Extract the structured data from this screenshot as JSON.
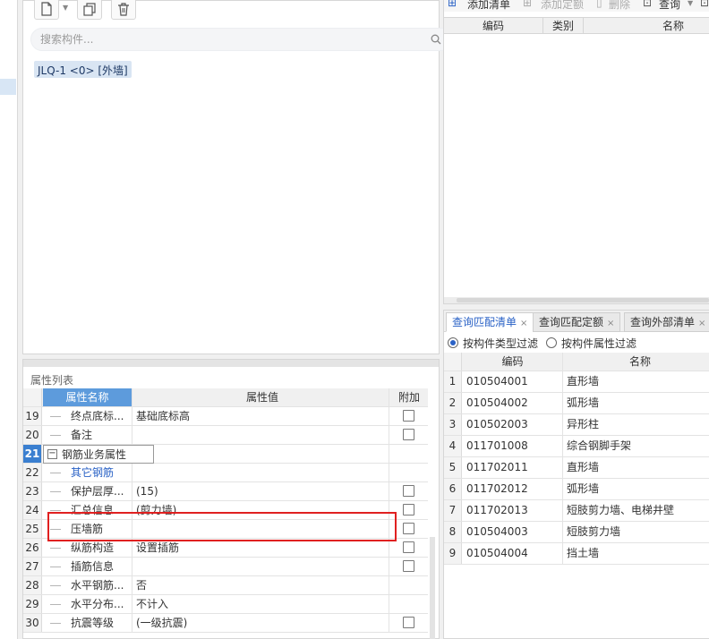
{
  "component_panel": {
    "search_placeholder": "搜索构件...",
    "selected_component": "JLQ-1 <0> [外墙]"
  },
  "property_panel": {
    "title": "属性列表",
    "headers": {
      "name": "属性名称",
      "value": "属性值",
      "add": "附加"
    },
    "rows": [
      {
        "num": "19",
        "name": "终点底标...",
        "value": "基础底标高",
        "checkbox": true
      },
      {
        "num": "20",
        "name": "备注",
        "value": "",
        "checkbox": true
      },
      {
        "num": "21",
        "name": "钢筋业务属性",
        "value": "",
        "checkbox": false,
        "group": true,
        "expander": "−"
      },
      {
        "num": "22",
        "name": "其它钢筋",
        "value": "",
        "checkbox": false,
        "link": true
      },
      {
        "num": "23",
        "name": "保护层厚...",
        "value": "(15)",
        "checkbox": true
      },
      {
        "num": "24",
        "name": "汇总信息",
        "value": "(剪力墙)",
        "checkbox": true
      },
      {
        "num": "25",
        "name": "压墙筋",
        "value": "",
        "checkbox": true
      },
      {
        "num": "26",
        "name": "纵筋构造",
        "value": "设置插筋",
        "checkbox": true
      },
      {
        "num": "27",
        "name": "插筋信息",
        "value": "",
        "checkbox": true
      },
      {
        "num": "28",
        "name": "水平钢筋...",
        "value": "否",
        "checkbox": false
      },
      {
        "num": "29",
        "name": "水平分布...",
        "value": "不计入",
        "checkbox": false
      },
      {
        "num": "30",
        "name": "抗震等级",
        "value": "(一级抗震)",
        "checkbox": true
      }
    ]
  },
  "bill_panel": {
    "toolbar": {
      "add_bill": "添加清单",
      "add_quota": "添加定额",
      "delete": "删除",
      "query": "查询"
    },
    "headers": {
      "code": "编码",
      "category": "类别",
      "name": "名称"
    }
  },
  "query_panel": {
    "tabs": [
      {
        "label": "查询匹配清单",
        "active": true
      },
      {
        "label": "查询匹配定额",
        "active": false
      },
      {
        "label": "查询外部清单",
        "active": false
      }
    ],
    "filter_by_type": "按构件类型过滤",
    "filter_by_attr": "按构件属性过滤",
    "headers": {
      "code": "编码",
      "name": "名称"
    },
    "rows": [
      {
        "num": "1",
        "code": "010504001",
        "name": "直形墙"
      },
      {
        "num": "2",
        "code": "010504002",
        "name": "弧形墙"
      },
      {
        "num": "3",
        "code": "010502003",
        "name": "异形柱"
      },
      {
        "num": "4",
        "code": "011701008",
        "name": "综合钢脚手架"
      },
      {
        "num": "5",
        "code": "011702011",
        "name": "直形墙"
      },
      {
        "num": "6",
        "code": "011702012",
        "name": "弧形墙"
      },
      {
        "num": "7",
        "code": "011702013",
        "name": "短肢剪力墙、电梯井壁"
      },
      {
        "num": "8",
        "code": "010504003",
        "name": "短肢剪力墙"
      },
      {
        "num": "9",
        "code": "010504004",
        "name": "挡土墙"
      }
    ]
  },
  "colors": {
    "accent": "#2a62c6",
    "header_blue": "#5d9bdc",
    "highlight_box": "#e02020"
  }
}
